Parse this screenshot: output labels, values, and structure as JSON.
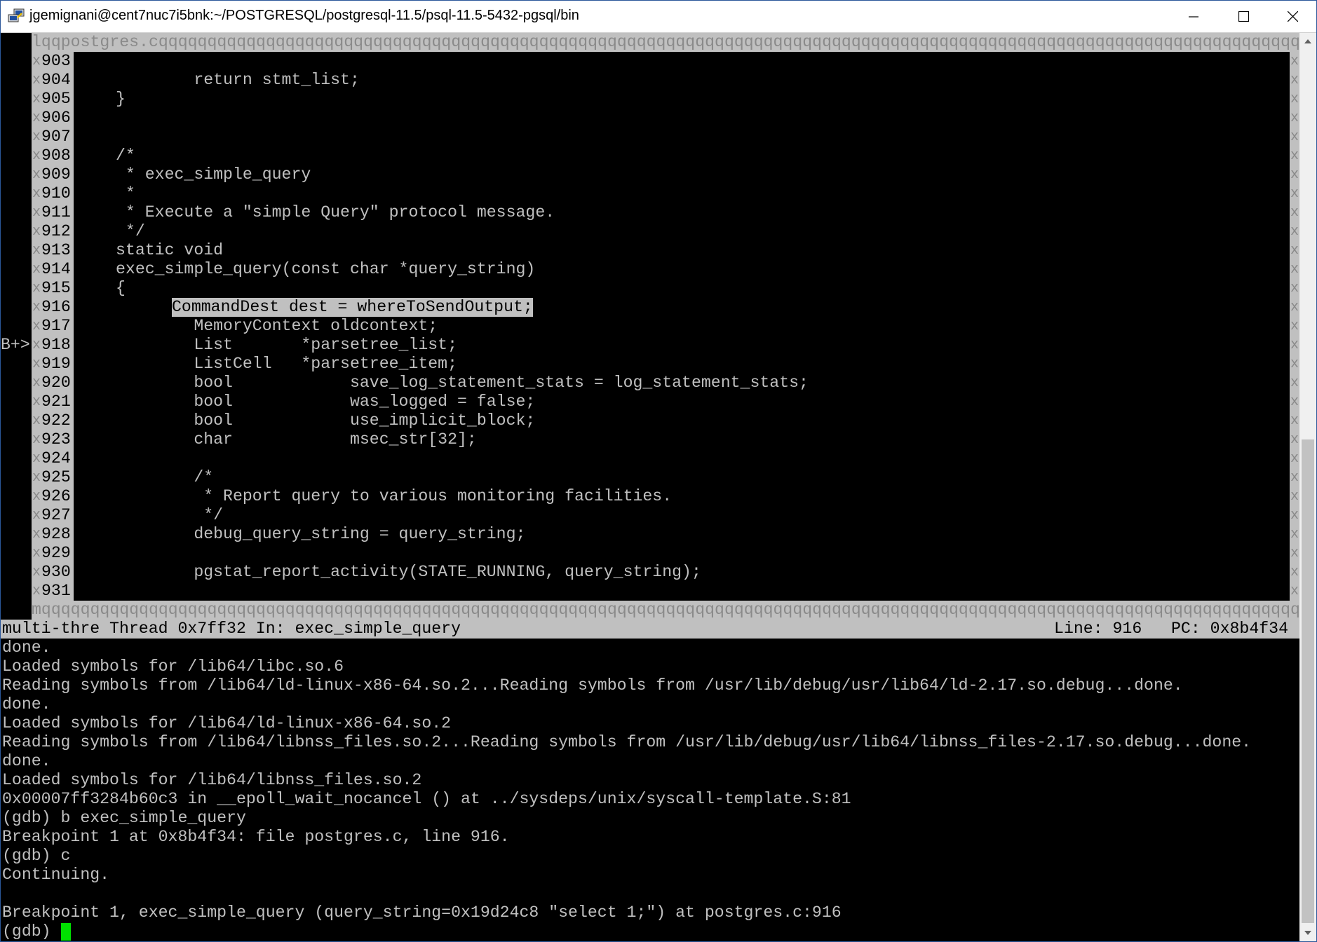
{
  "window": {
    "title": "jgemignani@cent7nuc7i5bnk:~/POSTGRESQL/postgresql-11.5/psql-11.5-5432-pgsql/bin",
    "controls": {
      "minimize": "minimize-icon",
      "maximize": "maximize-icon",
      "close": "close-icon"
    }
  },
  "source_panel": {
    "border_top": "lqqpostgres.cqqqqqqqqqqqqqqqqqqqqqqqqqqqqqqqqqqqqqqqqqqqqqqqqqqqqqqqqqqqqqqqqqqqqqqqqqqqqqqqqqqqqqqqqqqqqqqqqqqqqqqqqqqqqqqqqqqqqqqqqqqqqqqqqqk",
    "border_bottom": "mqqqqqqqqqqqqqqqqqqqqqqqqqqqqqqqqqqqqqqqqqqqqqqqqqqqqqqqqqqqqqqqqqqqqqqqqqqqqqqqqqqqqqqqqqqqqqqqqqqqqqqqqqqqqqqqqqqqqqqqqqqqqqqqqqqqqqqqj",
    "side_char": "x",
    "breakpoint_marker": "B+>",
    "lines": [
      {
        "no": "903",
        "text": ""
      },
      {
        "no": "904",
        "text": "        return stmt_list;"
      },
      {
        "no": "905",
        "text": "}"
      },
      {
        "no": "906",
        "text": ""
      },
      {
        "no": "907",
        "text": ""
      },
      {
        "no": "908",
        "text": "/*"
      },
      {
        "no": "909",
        "text": " * exec_simple_query"
      },
      {
        "no": "910",
        "text": " *"
      },
      {
        "no": "911",
        "text": " * Execute a \"simple Query\" protocol message."
      },
      {
        "no": "912",
        "text": " */"
      },
      {
        "no": "913",
        "text": "static void"
      },
      {
        "no": "914",
        "text": "exec_simple_query(const char *query_string)"
      },
      {
        "no": "915",
        "text": "{"
      },
      {
        "no": "916",
        "text": "CommandDest dest = whereToSendOutput;"
      },
      {
        "no": "917",
        "text": "        MemoryContext oldcontext;"
      },
      {
        "no": "918",
        "text": "        List       *parsetree_list;"
      },
      {
        "no": "919",
        "text": "        ListCell   *parsetree_item;"
      },
      {
        "no": "920",
        "text": "        bool            save_log_statement_stats = log_statement_stats;"
      },
      {
        "no": "921",
        "text": "        bool            was_logged = false;"
      },
      {
        "no": "922",
        "text": "        bool            use_implicit_block;"
      },
      {
        "no": "923",
        "text": "        char            msec_str[32];"
      },
      {
        "no": "924",
        "text": ""
      },
      {
        "no": "925",
        "text": "        /*"
      },
      {
        "no": "926",
        "text": "         * Report query to various monitoring facilities."
      },
      {
        "no": "927",
        "text": "         */"
      },
      {
        "no": "928",
        "text": "        debug_query_string = query_string;"
      },
      {
        "no": "929",
        "text": ""
      },
      {
        "no": "930",
        "text": "        pgstat_report_activity(STATE_RUNNING, query_string);"
      },
      {
        "no": "931",
        "text": ""
      }
    ]
  },
  "status_bar": {
    "left": "multi-thre Thread 0x7ff32 In: exec_simple_query",
    "right": "Line: 916   PC: 0x8b4f34"
  },
  "command_output": [
    "done.",
    "Loaded symbols for /lib64/libc.so.6",
    "Reading symbols from /lib64/ld-linux-x86-64.so.2...Reading symbols from /usr/lib/debug/usr/lib64/ld-2.17.so.debug...done.",
    "done.",
    "Loaded symbols for /lib64/ld-linux-x86-64.so.2",
    "Reading symbols from /lib64/libnss_files.so.2...Reading symbols from /usr/lib/debug/usr/lib64/libnss_files-2.17.so.debug...done.",
    "done.",
    "Loaded symbols for /lib64/libnss_files.so.2",
    "0x00007ff3284b60c3 in __epoll_wait_nocancel () at ../sysdeps/unix/syscall-template.S:81",
    "(gdb) b exec_simple_query",
    "Breakpoint 1 at 0x8b4f34: file postgres.c, line 916.",
    "(gdb) c",
    "Continuing.",
    "",
    "Breakpoint 1, exec_simple_query (query_string=0x19d24c8 \"select 1;\") at postgres.c:916"
  ],
  "prompt": "(gdb) ",
  "colors": {
    "cursor": "#00e000",
    "panel_grey": "#c0c0c0",
    "background": "#000000"
  }
}
